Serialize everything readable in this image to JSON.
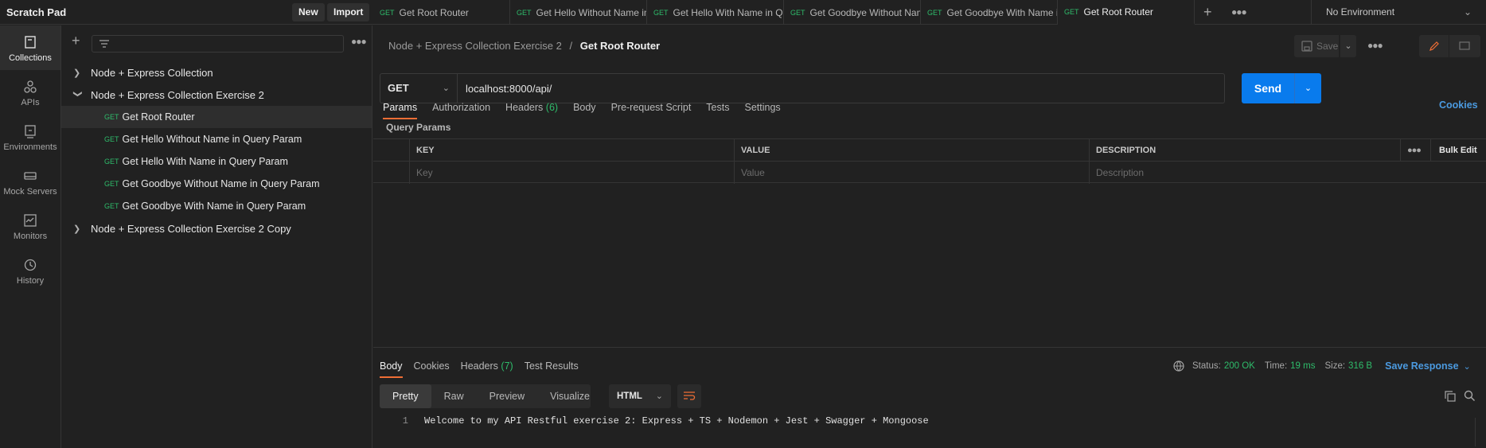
{
  "app": {
    "workspace_title": "Scratch Pad",
    "new_label": "New",
    "import_label": "Import",
    "environment": "No Environment"
  },
  "tabs": [
    {
      "method": "GET",
      "title": "Get Root Router",
      "active": false
    },
    {
      "method": "GET",
      "title": "Get Hello Without Name in Query Param",
      "active": false
    },
    {
      "method": "GET",
      "title": "Get Hello With Name in Query Param",
      "active": false
    },
    {
      "method": "GET",
      "title": "Get Goodbye Without Name in Query Param",
      "active": false
    },
    {
      "method": "GET",
      "title": "Get Goodbye With Name in Query Param",
      "active": false
    },
    {
      "method": "GET",
      "title": "Get Root Router",
      "active": true
    }
  ],
  "rail": [
    {
      "label": "Collections",
      "icon": "collections-icon",
      "active": true
    },
    {
      "label": "APIs",
      "icon": "apis-icon",
      "active": false
    },
    {
      "label": "Environments",
      "icon": "environments-icon",
      "active": false
    },
    {
      "label": "Mock Servers",
      "icon": "mock-servers-icon",
      "active": false
    },
    {
      "label": "Monitors",
      "icon": "monitors-icon",
      "active": false
    },
    {
      "label": "History",
      "icon": "history-icon",
      "active": false
    }
  ],
  "sidebar": {
    "search_placeholder": "",
    "tree": [
      {
        "type": "collection",
        "name": "Node + Express Collection",
        "expanded": false
      },
      {
        "type": "collection",
        "name": "Node + Express Collection Exercise 2",
        "expanded": true
      },
      {
        "type": "request",
        "method": "GET",
        "name": "Get Root Router",
        "selected": true
      },
      {
        "type": "request",
        "method": "GET",
        "name": "Get Hello Without Name in Query Param",
        "selected": false
      },
      {
        "type": "request",
        "method": "GET",
        "name": "Get Hello With Name in Query Param",
        "selected": false
      },
      {
        "type": "request",
        "method": "GET",
        "name": "Get Goodbye Without Name in Query Param",
        "selected": false
      },
      {
        "type": "request",
        "method": "GET",
        "name": "Get Goodbye With Name in Query Param",
        "selected": false
      },
      {
        "type": "collection",
        "name": "Node + Express Collection Exercise 2 Copy",
        "expanded": false
      }
    ]
  },
  "request": {
    "breadcrumb_parent": "Node + Express Collection Exercise 2",
    "breadcrumb_sep": "/",
    "breadcrumb_current": "Get Root Router",
    "save_label": "Save",
    "method": "GET",
    "url": "localhost:8000/api/",
    "send_label": "Send",
    "tabs": [
      {
        "label": "Params",
        "count": "",
        "active": true
      },
      {
        "label": "Authorization",
        "count": "",
        "active": false
      },
      {
        "label": "Headers",
        "count": "(6)",
        "active": false
      },
      {
        "label": "Body",
        "count": "",
        "active": false
      },
      {
        "label": "Pre-request Script",
        "count": "",
        "active": false
      },
      {
        "label": "Tests",
        "count": "",
        "active": false
      },
      {
        "label": "Settings",
        "count": "",
        "active": false
      }
    ],
    "cookies_label": "Cookies",
    "query_params_title": "Query Params",
    "params_table": {
      "headers": {
        "key": "KEY",
        "value": "VALUE",
        "description": "DESCRIPTION",
        "bulk_edit": "Bulk Edit"
      },
      "placeholders": {
        "key": "Key",
        "value": "Value",
        "description": "Description"
      }
    }
  },
  "response": {
    "tabs": [
      {
        "label": "Body",
        "count": "",
        "active": true
      },
      {
        "label": "Cookies",
        "count": "",
        "active": false
      },
      {
        "label": "Headers",
        "count": "(7)",
        "active": false
      },
      {
        "label": "Test Results",
        "count": "",
        "active": false
      }
    ],
    "status_label": "Status:",
    "status_value": "200 OK",
    "time_label": "Time:",
    "time_value": "19 ms",
    "size_label": "Size:",
    "size_value": "316 B",
    "save_response_label": "Save Response",
    "format_tabs": [
      {
        "label": "Pretty",
        "active": true
      },
      {
        "label": "Raw",
        "active": false
      },
      {
        "label": "Preview",
        "active": false
      },
      {
        "label": "Visualize",
        "active": false
      }
    ],
    "language": "HTML",
    "body_lines": [
      {
        "num": "1",
        "text": "Welcome to my API Restful exercise 2: Express + TS + Nodemon + Jest + Swagger + Mongoose"
      }
    ]
  },
  "colors": {
    "accent_orange": "#ef6e35",
    "send_blue": "#097bed",
    "method_green": "#2ebb6a",
    "link_blue": "#4b9ae0"
  }
}
